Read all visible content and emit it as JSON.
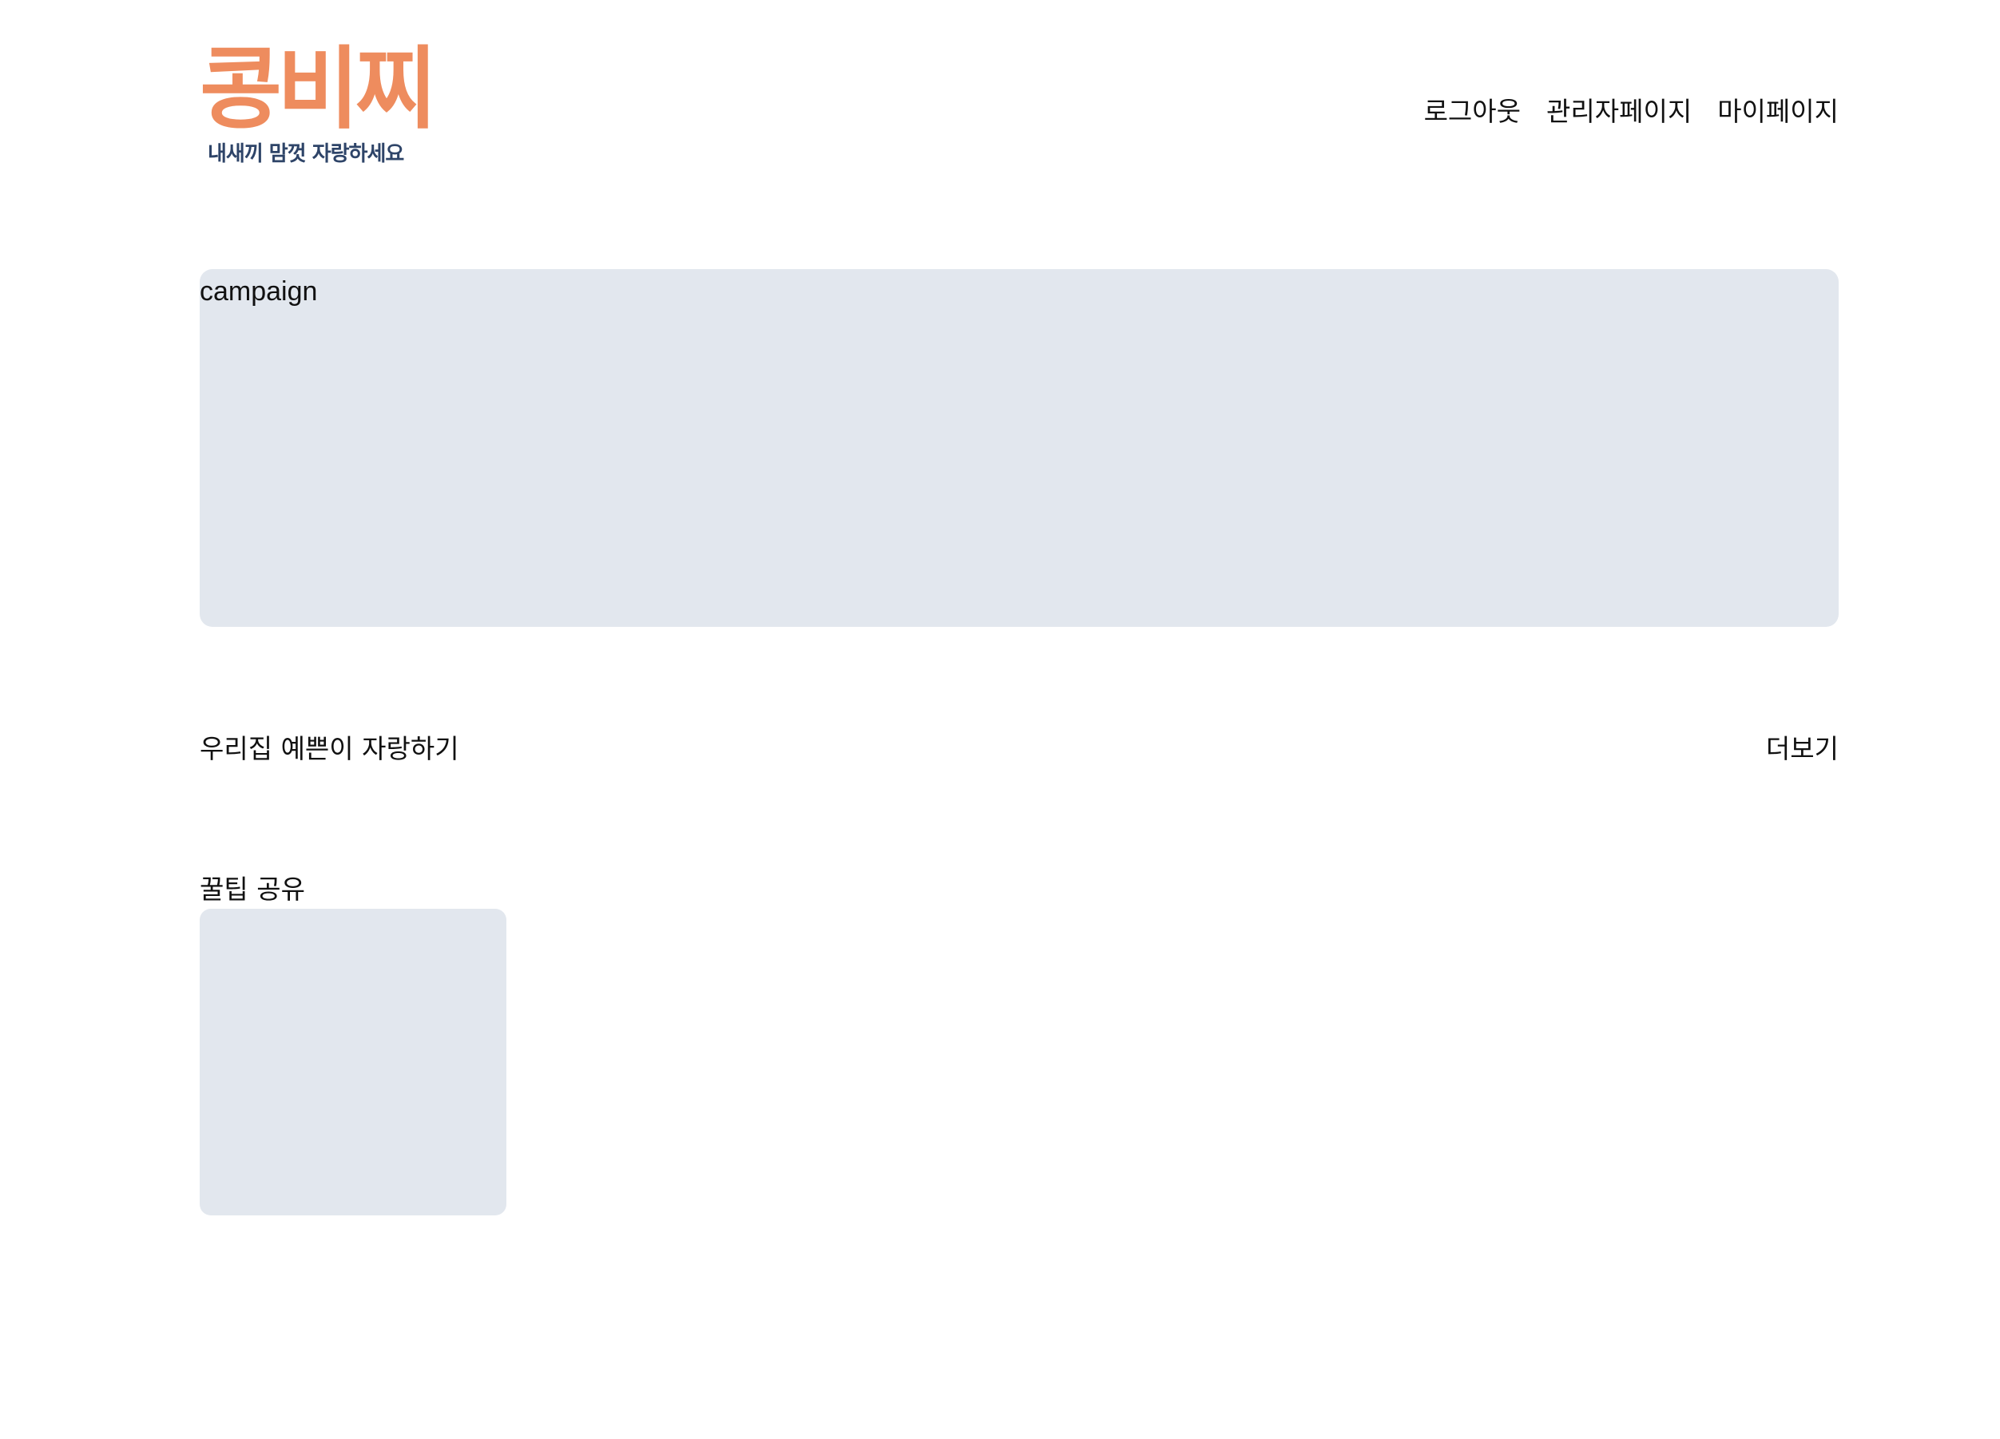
{
  "header": {
    "logo_title": "콩비찌",
    "logo_tagline": "내새끼 맘껏 자랑하세요",
    "nav": [
      {
        "label": "로그아웃"
      },
      {
        "label": "관리자페이지"
      },
      {
        "label": "마이페이지"
      }
    ]
  },
  "campaign": {
    "label": "campaign"
  },
  "pet_section": {
    "title": "우리집 예쁜이 자랑하기",
    "more_label": "더보기"
  },
  "tips_section": {
    "title": "꿀팁 공유"
  },
  "colors": {
    "brand": "#ee8c5e",
    "tagline": "#2e4468",
    "placeholder": "#e2e7ee"
  }
}
